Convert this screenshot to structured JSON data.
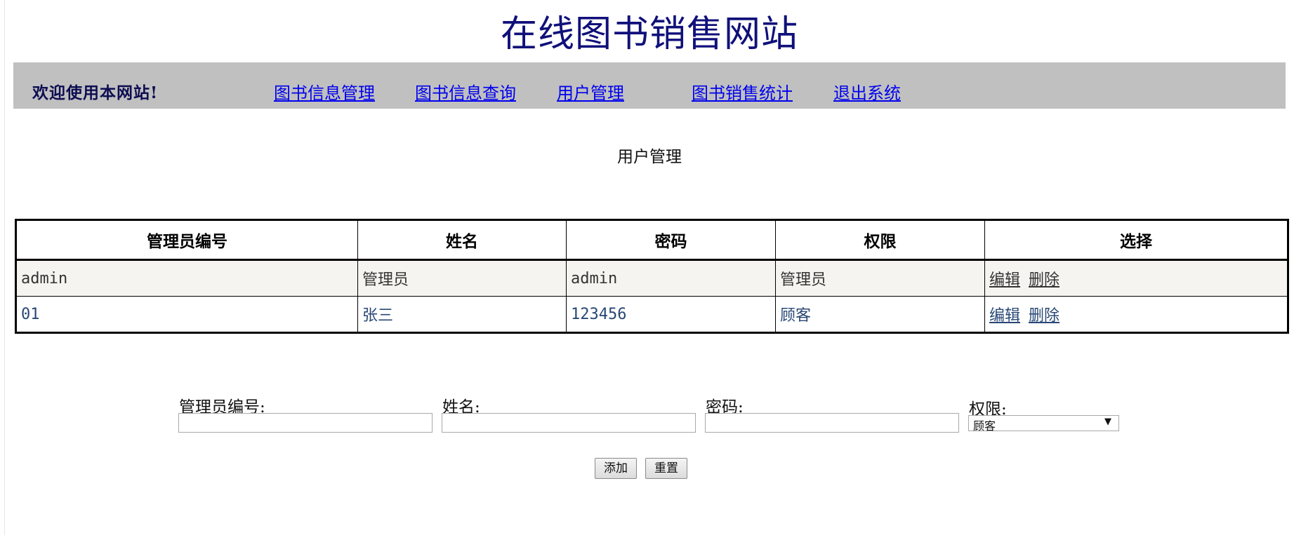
{
  "site_title": "在线图书销售网站",
  "nav": {
    "welcome": "欢迎使用本网站!",
    "links": [
      "图书信息管理",
      "图书信息查询",
      "用户管理",
      "图书销售统计",
      "退出系统"
    ]
  },
  "page_heading": "用户管理",
  "table": {
    "headers": [
      "管理员编号",
      "姓名",
      "密码",
      "权限",
      "选择"
    ],
    "rows": [
      {
        "id": "admin",
        "name": "管理员",
        "password": "admin",
        "role": "管理员",
        "edit": "编辑",
        "delete": "删除"
      },
      {
        "id": "01",
        "name": "张三",
        "password": "123456",
        "role": "顾客",
        "edit": "编辑",
        "delete": "删除"
      }
    ]
  },
  "form": {
    "id_label": "管理员编号:",
    "id_value": "",
    "name_label": "姓名:",
    "name_value": "",
    "password_label": "密码:",
    "password_value": "",
    "role_label": "权限:",
    "role_selected": "顾客",
    "add_button": "添加",
    "reset_button": "重置"
  },
  "colors": {
    "title": "#10107a",
    "nav_background": "#c0c0c0",
    "link": "#0000ee",
    "row_alt_background": "#f5f4f0",
    "row_text": "#284775"
  },
  "icons": {
    "select_arrow": "triangle-down-icon"
  }
}
